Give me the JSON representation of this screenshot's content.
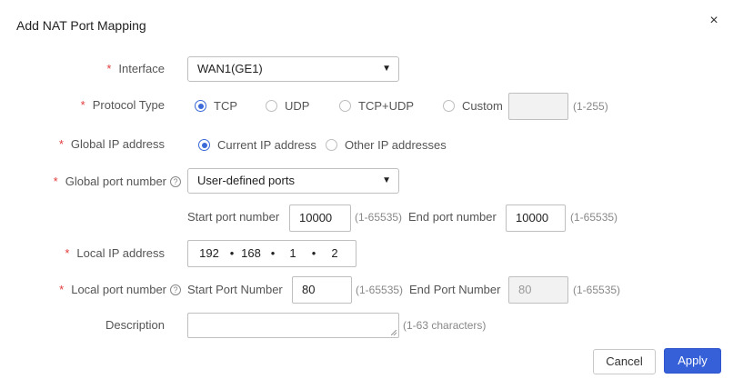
{
  "dialog": {
    "title": "Add NAT Port Mapping",
    "close_glyph": "×"
  },
  "required_mark": "*",
  "help_glyph": "?",
  "interface": {
    "label": "Interface",
    "value": "WAN1(GE1)"
  },
  "protocol": {
    "label": "Protocol Type",
    "options": [
      "TCP",
      "UDP",
      "TCP+UDP",
      "Custom"
    ],
    "selected": "TCP",
    "custom_value": "",
    "custom_hint": "(1-255)"
  },
  "global_ip": {
    "label": "Global IP address",
    "options": [
      "Current IP address",
      "Other IP addresses"
    ],
    "selected": "Current IP address"
  },
  "global_port": {
    "label": "Global port number",
    "value": "User-defined ports",
    "start_label": "Start port number",
    "start_value": "10000",
    "start_hint": "(1-65535)",
    "end_label": "End port number",
    "end_value": "10000",
    "end_hint": "(1-65535)"
  },
  "local_ip": {
    "label": "Local IP address",
    "octets": [
      "192",
      "168",
      "1",
      "2"
    ]
  },
  "local_port": {
    "label": "Local port number",
    "start_label": "Start Port Number",
    "start_value": "80",
    "start_hint": "(1-65535)",
    "end_label": "End Port Number",
    "end_value": "80",
    "end_hint": "(1-65535)"
  },
  "description": {
    "label": "Description",
    "value": "",
    "hint": "(1-63 characters)"
  },
  "buttons": {
    "cancel": "Cancel",
    "apply": "Apply"
  },
  "colors": {
    "accent": "#3560d8",
    "required": "#e23b3b"
  },
  "icons": {
    "close": "close-icon",
    "help": "help-icon",
    "dropdown": "chevron-down-icon"
  }
}
